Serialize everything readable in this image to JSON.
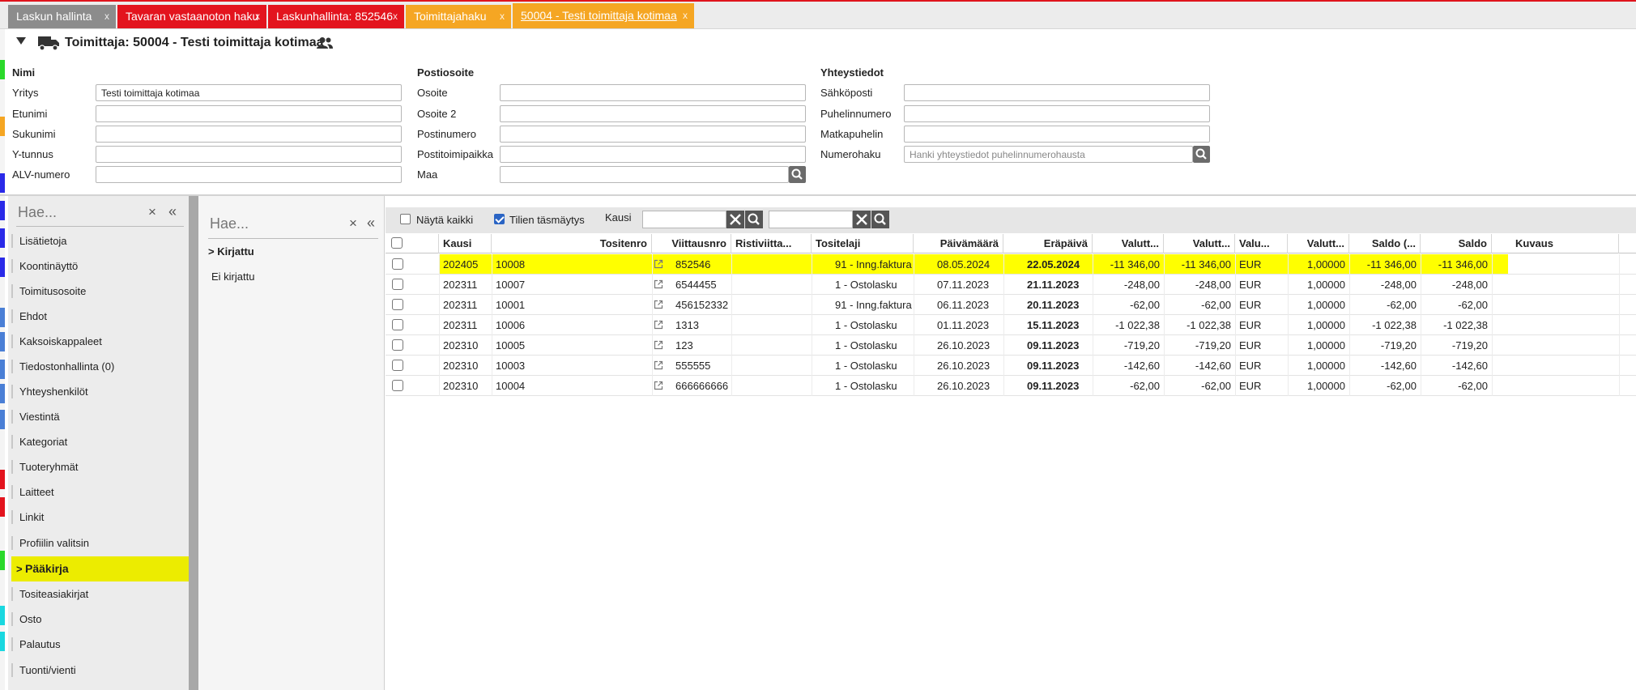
{
  "tabs": [
    {
      "label": "Laskun hallinta",
      "color": "#8c8c8c",
      "active": false
    },
    {
      "label": "Tavaran vastaanoton haku",
      "color": "#e3141e",
      "active": false
    },
    {
      "label": "Laskunhallinta: 852546",
      "color": "#e3141e",
      "active": false
    },
    {
      "label": "Toimittajahaku",
      "color": "#f5a623",
      "active": false
    },
    {
      "label": "50004 - Testi toimittaja kotimaa",
      "color": "#f5a623",
      "active": true
    }
  ],
  "tab_close": "x",
  "header": {
    "title": "Toimittaja: 50004 - Testi toimittaja kotimaa"
  },
  "form": {
    "name_section": {
      "title": "Nimi",
      "fields": [
        {
          "label": "Yritys",
          "value": "Testi toimittaja kotimaa"
        },
        {
          "label": "Etunimi",
          "value": ""
        },
        {
          "label": "Sukunimi",
          "value": ""
        },
        {
          "label": "Y-tunnus",
          "value": ""
        },
        {
          "label": "ALV-numero",
          "value": ""
        }
      ]
    },
    "address_section": {
      "title": "Postiosoite",
      "fields": [
        {
          "label": "Osoite",
          "value": ""
        },
        {
          "label": "Osoite 2",
          "value": ""
        },
        {
          "label": "Postinumero",
          "value": ""
        },
        {
          "label": "Postitoimipaikka",
          "value": ""
        },
        {
          "label": "Maa",
          "value": ""
        }
      ]
    },
    "contact_section": {
      "title": "Yhteystiedot",
      "fields": [
        {
          "label": "Sähköposti",
          "value": ""
        },
        {
          "label": "Puhelinnumero",
          "value": ""
        },
        {
          "label": "Matkapuhelin",
          "value": ""
        },
        {
          "label": "Numerohaku",
          "value": "",
          "placeholder": "Hanki yhteystiedot puhelinnumerohausta"
        }
      ]
    }
  },
  "sidebar": {
    "search_placeholder": "Hae...",
    "clear": "×",
    "collapse": "«",
    "items": [
      {
        "label": "Lisätietoja"
      },
      {
        "label": "Koontinäyttö"
      },
      {
        "label": "Toimitusosoite"
      },
      {
        "label": "Ehdot"
      },
      {
        "label": "Kaksoiskappaleet"
      },
      {
        "label": "Tiedostonhallinta (0)"
      },
      {
        "label": "Yhteyshenkilöt"
      },
      {
        "label": "Viestintä"
      },
      {
        "label": "Kategoriat"
      },
      {
        "label": "Tuoteryhmät"
      },
      {
        "label": "Laitteet"
      },
      {
        "label": "Linkit"
      },
      {
        "label": "Profiilin valitsin"
      },
      {
        "label": "Pääkirja",
        "selected": true
      },
      {
        "label": "Tositeasiakirjat"
      },
      {
        "label": "Osto"
      },
      {
        "label": "Palautus"
      },
      {
        "label": "Tuonti/vienti"
      }
    ]
  },
  "filter_panel": {
    "search_placeholder": "Hae...",
    "clear": "×",
    "collapse": "«",
    "items": [
      {
        "label": "Kirjattu"
      },
      {
        "label": "Ei kirjattu"
      }
    ]
  },
  "toolbar": {
    "show_all_label": "Näytä kaikki",
    "show_all_checked": false,
    "match_label": "Tilien täsmäytys",
    "match_checked": true,
    "period_label": "Kausi",
    "period_from": "",
    "period_to": ""
  },
  "table": {
    "columns": [
      "Kausi",
      "Tositenro",
      "Viittausnro",
      "Ristiviitta...",
      "Tositelaji",
      "Päivämäärä",
      "Eräpäivä",
      "Valutt...",
      "Valutt...",
      "Valu...",
      "Valutt...",
      "Saldo (...",
      "Saldo",
      "Kuvaus"
    ],
    "rows": [
      {
        "kausi": "202405",
        "tositenro": "10008",
        "viittausnro": "852546",
        "risti": "",
        "tositelaji": "91 - Inng.faktura",
        "pvm": "08.05.2024",
        "erapaiva": "22.05.2024",
        "v1": "-11 346,00",
        "v2": "-11 346,00",
        "valuutta": "EUR",
        "kurssi": "1,00000",
        "saldo_v": "-11 346,00",
        "saldo": "-11 346,00",
        "kuvaus": "",
        "highlight": true
      },
      {
        "kausi": "202311",
        "tositenro": "10007",
        "viittausnro": "6544455",
        "risti": "",
        "tositelaji": "1 - Ostolasku",
        "pvm": "07.11.2023",
        "erapaiva": "21.11.2023",
        "v1": "-248,00",
        "v2": "-248,00",
        "valuutta": "EUR",
        "kurssi": "1,00000",
        "saldo_v": "-248,00",
        "saldo": "-248,00",
        "kuvaus": ""
      },
      {
        "kausi": "202311",
        "tositenro": "10001",
        "viittausnro": "456152332",
        "risti": "",
        "tositelaji": "91 - Inng.faktura",
        "pvm": "06.11.2023",
        "erapaiva": "20.11.2023",
        "v1": "-62,00",
        "v2": "-62,00",
        "valuutta": "EUR",
        "kurssi": "1,00000",
        "saldo_v": "-62,00",
        "saldo": "-62,00",
        "kuvaus": ""
      },
      {
        "kausi": "202311",
        "tositenro": "10006",
        "viittausnro": "1313",
        "risti": "",
        "tositelaji": "1 - Ostolasku",
        "pvm": "01.11.2023",
        "erapaiva": "15.11.2023",
        "v1": "-1 022,38",
        "v2": "-1 022,38",
        "valuutta": "EUR",
        "kurssi": "1,00000",
        "saldo_v": "-1 022,38",
        "saldo": "-1 022,38",
        "kuvaus": ""
      },
      {
        "kausi": "202310",
        "tositenro": "10005",
        "viittausnro": "123",
        "risti": "",
        "tositelaji": "1 - Ostolasku",
        "pvm": "26.10.2023",
        "erapaiva": "09.11.2023",
        "v1": "-719,20",
        "v2": "-719,20",
        "valuutta": "EUR",
        "kurssi": "1,00000",
        "saldo_v": "-719,20",
        "saldo": "-719,20",
        "kuvaus": ""
      },
      {
        "kausi": "202310",
        "tositenro": "10003",
        "viittausnro": "555555",
        "risti": "",
        "tositelaji": "1 - Ostolasku",
        "pvm": "26.10.2023",
        "erapaiva": "09.11.2023",
        "v1": "-142,60",
        "v2": "-142,60",
        "valuutta": "EUR",
        "kurssi": "1,00000",
        "saldo_v": "-142,60",
        "saldo": "-142,60",
        "kuvaus": ""
      },
      {
        "kausi": "202310",
        "tositenro": "10004",
        "viittausnro": "666666666",
        "risti": "",
        "tositelaji": "1 - Ostolasku",
        "pvm": "26.10.2023",
        "erapaiva": "09.11.2023",
        "v1": "-62,00",
        "v2": "-62,00",
        "valuutta": "EUR",
        "kurssi": "1,00000",
        "saldo_v": "-62,00",
        "saldo": "-62,00",
        "kuvaus": ""
      }
    ]
  },
  "colors": {
    "highlight": "#ffff00",
    "sidebar_selected": "#ecec00",
    "accent_red": "#e3141e",
    "accent_orange": "#f5a623"
  }
}
